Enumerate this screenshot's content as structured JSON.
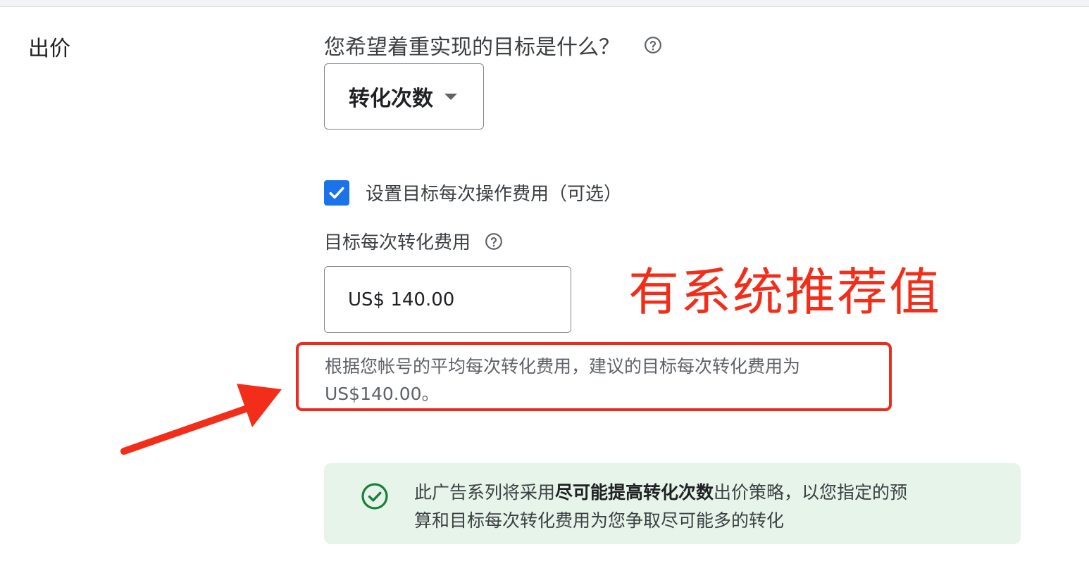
{
  "section": {
    "title": "出价"
  },
  "goal": {
    "question": "您希望着重实现的目标是什么？",
    "selected": "转化次数"
  },
  "target_cpa_toggle": {
    "checked": true,
    "label": "设置目标每次操作费用（可选）"
  },
  "target_cpa_field": {
    "label": "目标每次转化费用",
    "value": "US$ 140.00"
  },
  "recommendation": {
    "line1": "根据您帐号的平均每次转化费用，建议的目标每次转化费用为",
    "line2": "US$140.00。"
  },
  "annotation": {
    "text": "有系统推荐值",
    "color": "#f22e1a"
  },
  "banner": {
    "prefix": "此广告系列将采用",
    "strategy": "尽可能提高转化次数",
    "suffix_line1": "出价策略，以您指定的预",
    "line2": "算和目标每次转化费用为您争取尽可能多的转化"
  },
  "icons": {
    "goal_help": "help-circle-icon",
    "field_help": "help-circle-icon",
    "dropdown": "caret-down-icon",
    "checkbox": "check-icon",
    "banner": "check-circle-icon",
    "annotation_arrow": "red-arrow-icon"
  },
  "colors": {
    "accent_blue": "#1a73e8",
    "annotation_red": "#ee2a1b",
    "success_green": "#188038",
    "banner_bg": "#e6f4ea"
  }
}
